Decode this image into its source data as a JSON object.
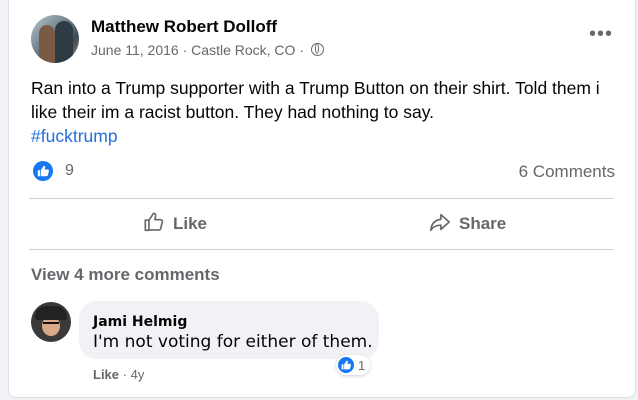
{
  "post": {
    "author": "Matthew Robert Dolloff",
    "date": "June 11, 2016",
    "location": "Castle Rock, CO",
    "separator": "·",
    "privacy_icon": "globe-icon",
    "more_icon": "ellipsis-icon",
    "more_label": "•••",
    "text": "Ran into a Trump supporter with a Trump Button on their shirt. Told them i like their im a racist button. They had nothing to say.",
    "hashtag": "#fucktrump"
  },
  "stats": {
    "like_count": "9",
    "comments_count": "6 Comments"
  },
  "actions": {
    "like_label": "Like",
    "share_label": "Share"
  },
  "comments": {
    "view_more": "View 4 more comments",
    "items": [
      {
        "author": "Jami Helmig",
        "text": "I'm not voting for either of them.",
        "reaction_count": "1",
        "like_label": "Like",
        "separator": "·",
        "age": "4y"
      }
    ]
  },
  "colors": {
    "accent": "#1877f2",
    "hashtag": "#216fdb",
    "secondary_text": "#65676b"
  }
}
